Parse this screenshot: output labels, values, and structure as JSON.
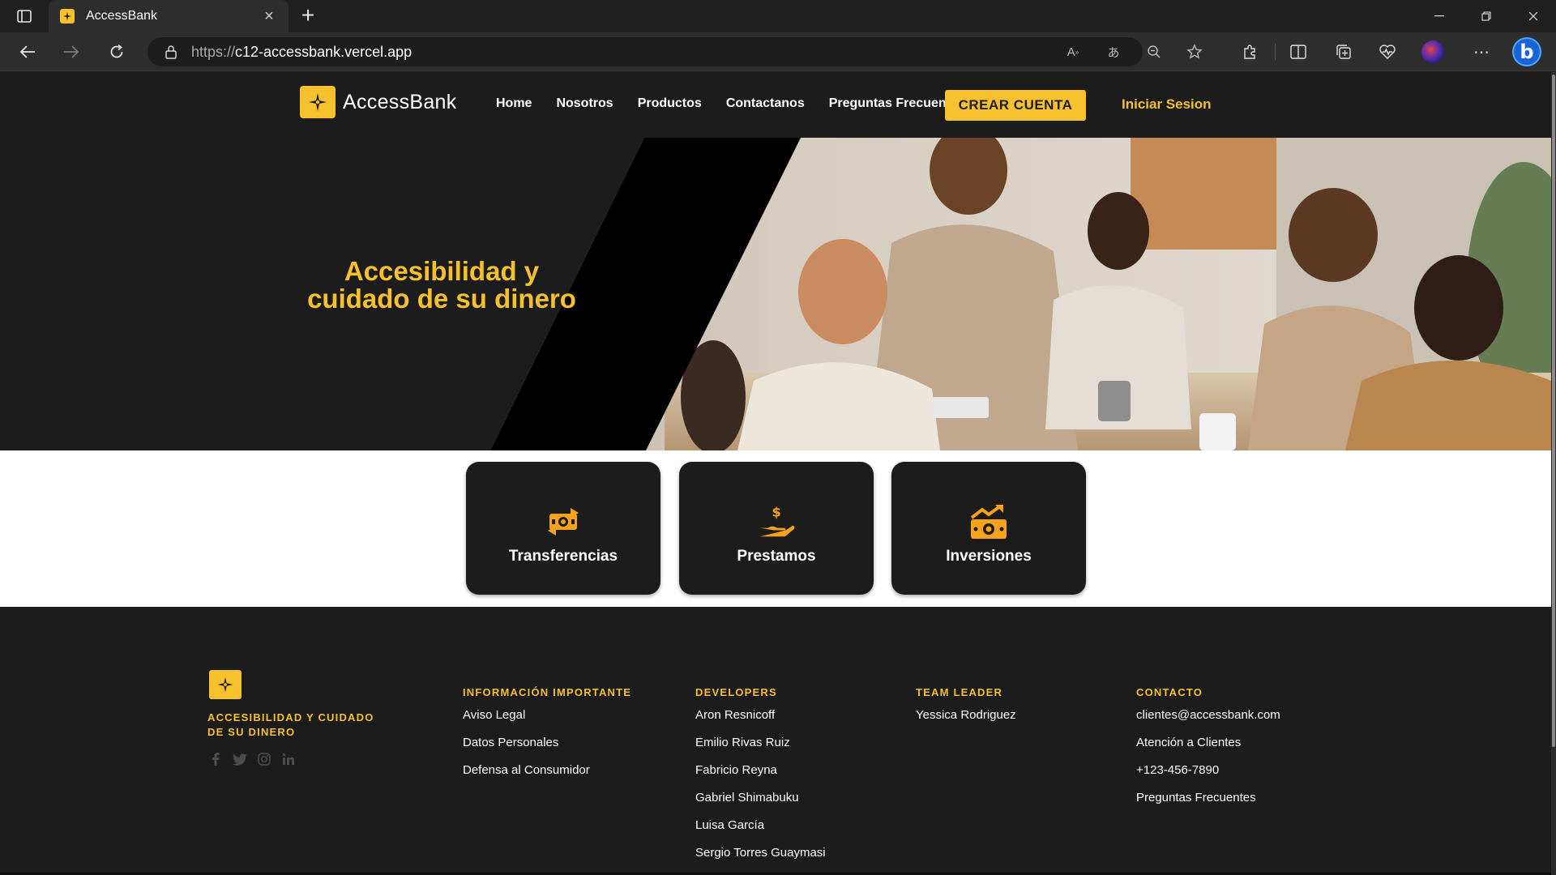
{
  "browser": {
    "tab_title": "AccessBank",
    "url_prefix": "https://",
    "url_host": "c12-accessbank.vercel.app"
  },
  "header": {
    "logo_text": "AccessBank",
    "nav": [
      "Home",
      "Nosotros",
      "Productos",
      "Contactanos",
      "Preguntas Frecuentes"
    ],
    "cta_label": "CREAR CUENTA",
    "login_label": "Iniciar Sesion"
  },
  "hero": {
    "title_line1": "Accesibilidad y",
    "title_line2": "cuidado de su dinero"
  },
  "services": [
    {
      "label": "Transferencias",
      "icon": "money-transfer-icon"
    },
    {
      "label": "Prestamos",
      "icon": "hand-dollar-icon"
    },
    {
      "label": "Inversiones",
      "icon": "investment-growth-icon"
    }
  ],
  "footer": {
    "tagline": "Accesibilidad y cuidado de su dinero",
    "social": [
      "facebook-icon",
      "twitter-icon",
      "instagram-icon",
      "linkedin-icon"
    ],
    "columns": [
      {
        "heading": "Información importante",
        "links": [
          "Aviso Legal",
          "Datos Personales",
          "Defensa al Consumidor"
        ]
      },
      {
        "heading": "Developers",
        "links": [
          "Aron Resnicoff",
          "Emilio Rivas Ruiz",
          "Fabricio Reyna",
          "Gabriel Shimabuku",
          "Luisa García",
          "Sergio Torres Guaymasi"
        ]
      },
      {
        "heading": "Team Leader",
        "links": [
          "Yessica Rodriguez"
        ]
      },
      {
        "heading": "Contacto",
        "links": [
          "clientes@accessbank.com",
          "Atención a Clientes",
          "+123-456-7890",
          "Preguntas Frecuentes"
        ]
      }
    ]
  },
  "colors": {
    "accent": "#f6c12c",
    "dark": "#1c1c1c",
    "white": "#ffffff"
  }
}
